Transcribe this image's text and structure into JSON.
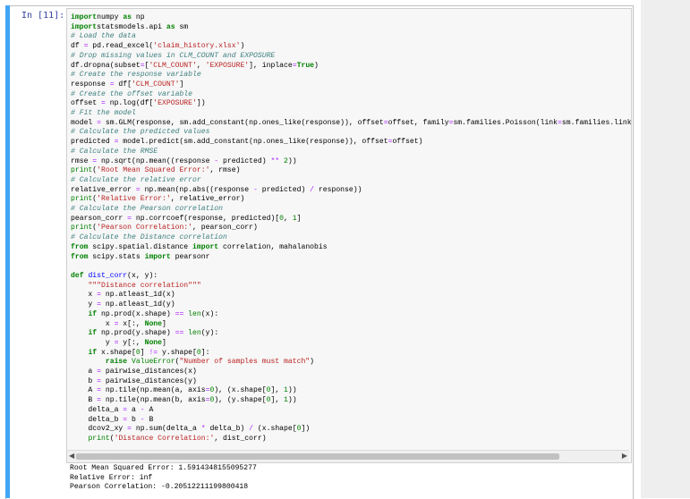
{
  "cell": {
    "prompt": "In [11]:",
    "code_lines": [
      [
        [
          "kw",
          "import"
        ],
        [
          "",
          "numpy "
        ],
        [
          "kw",
          "as"
        ],
        [
          "",
          " np"
        ]
      ],
      [
        [
          "kw",
          "import"
        ],
        [
          "",
          "statsmodels.api "
        ],
        [
          "kw",
          "as"
        ],
        [
          "",
          " sm"
        ]
      ],
      [
        [
          "cm",
          "# Load the data"
        ]
      ],
      [
        [
          "",
          "df "
        ],
        [
          "op",
          "="
        ],
        [
          "",
          " pd.read_excel("
        ],
        [
          "st",
          "'claim_history.xlsx'"
        ],
        [
          "",
          ")"
        ]
      ],
      [
        [
          "cm",
          "# Drop missing values in CLM_COUNT and EXPOSURE"
        ]
      ],
      [
        [
          "",
          "df.dropna(subset"
        ],
        [
          "op",
          "="
        ],
        [
          "",
          "["
        ],
        [
          "st",
          "'CLM_COUNT'"
        ],
        [
          "",
          ", "
        ],
        [
          "st",
          "'EXPOSURE'"
        ],
        [
          "",
          "], inplace"
        ],
        [
          "op",
          "="
        ],
        [
          "kw",
          "True"
        ],
        [
          "",
          ")"
        ]
      ],
      [
        [
          "cm",
          "# Create the response variable"
        ]
      ],
      [
        [
          "",
          "response "
        ],
        [
          "op",
          "="
        ],
        [
          "",
          " df["
        ],
        [
          "st",
          "'CLM_COUNT'"
        ],
        [
          "",
          "]"
        ]
      ],
      [
        [
          "cm",
          "# Create the offset variable"
        ]
      ],
      [
        [
          "",
          "offset "
        ],
        [
          "op",
          "="
        ],
        [
          "",
          " np.log(df["
        ],
        [
          "st",
          "'EXPOSURE'"
        ],
        [
          "",
          "])"
        ]
      ],
      [
        [
          "cm",
          "# Fit the model"
        ]
      ],
      [
        [
          "",
          "model "
        ],
        [
          "op",
          "="
        ],
        [
          "",
          " sm.GLM(response, sm.add_constant(np.ones_like(response)), offset"
        ],
        [
          "op",
          "="
        ],
        [
          "",
          "offset, family"
        ],
        [
          "op",
          "="
        ],
        [
          "",
          "sm.families.Poisson(link"
        ],
        [
          "op",
          "="
        ],
        [
          "",
          "sm.families.link"
        ]
      ],
      [
        [
          "cm",
          "# Calculate the predicted values"
        ]
      ],
      [
        [
          "",
          "predicted "
        ],
        [
          "op",
          "="
        ],
        [
          "",
          " model.predict(sm.add_constant(np.ones_like(response)), offset"
        ],
        [
          "op",
          "="
        ],
        [
          "",
          "offset)"
        ]
      ],
      [
        [
          "cm",
          "# Calculate the RMSE"
        ]
      ],
      [
        [
          "",
          "rmse "
        ],
        [
          "op",
          "="
        ],
        [
          "",
          " np.sqrt(np.mean((response "
        ],
        [
          "op",
          "-"
        ],
        [
          "",
          " predicted) "
        ],
        [
          "op",
          "**"
        ],
        [
          "",
          " "
        ],
        [
          "nm",
          "2"
        ],
        [
          "",
          "))"
        ]
      ],
      [
        [
          "nm",
          "print"
        ],
        [
          "",
          "("
        ],
        [
          "st",
          "'Root Mean Squared Error:'"
        ],
        [
          "",
          ", rmse)"
        ]
      ],
      [
        [
          "cm",
          "# Calculate the relative error"
        ]
      ],
      [
        [
          "",
          "relative_error "
        ],
        [
          "op",
          "="
        ],
        [
          "",
          " np.mean(np.abs((response "
        ],
        [
          "op",
          "-"
        ],
        [
          "",
          " predicted) "
        ],
        [
          "op",
          "/"
        ],
        [
          "",
          " response))"
        ]
      ],
      [
        [
          "nm",
          "print"
        ],
        [
          "",
          "("
        ],
        [
          "st",
          "'Relative Error:'"
        ],
        [
          "",
          ", relative_error)"
        ]
      ],
      [
        [
          "cm",
          "# Calculate the Pearson correlation"
        ]
      ],
      [
        [
          "",
          "pearson_corr "
        ],
        [
          "op",
          "="
        ],
        [
          "",
          " np.corrcoef(response, predicted)["
        ],
        [
          "nm",
          "0"
        ],
        [
          "",
          ", "
        ],
        [
          "nm",
          "1"
        ],
        [
          "",
          "]"
        ]
      ],
      [
        [
          "nm",
          "print"
        ],
        [
          "",
          "("
        ],
        [
          "st",
          "'Pearson Correlation:'"
        ],
        [
          "",
          ", pearson_corr)"
        ]
      ],
      [
        [
          "cm",
          "# Calculate the Distance correlation"
        ]
      ],
      [
        [
          "kw",
          "from"
        ],
        [
          "",
          " scipy.spatial.distance "
        ],
        [
          "kw",
          "import"
        ],
        [
          "",
          " correlation, mahalanobis"
        ]
      ],
      [
        [
          "kw",
          "from"
        ],
        [
          "",
          " scipy.stats "
        ],
        [
          "kw",
          "import"
        ],
        [
          "",
          " pearsonr"
        ]
      ],
      [
        [
          "",
          ""
        ]
      ],
      [
        [
          "kw",
          "def"
        ],
        [
          "",
          " "
        ],
        [
          "fn",
          "dist_corr"
        ],
        [
          "",
          "(x, y):"
        ]
      ],
      [
        [
          "",
          "    "
        ],
        [
          "st",
          "\"\"\"Distance correlation\"\"\""
        ]
      ],
      [
        [
          "",
          "    x "
        ],
        [
          "op",
          "="
        ],
        [
          "",
          " np.atleast_1d(x)"
        ]
      ],
      [
        [
          "",
          "    y "
        ],
        [
          "op",
          "="
        ],
        [
          "",
          " np.atleast_1d(y)"
        ]
      ],
      [
        [
          "",
          "    "
        ],
        [
          "kw",
          "if"
        ],
        [
          "",
          " np.prod(x.shape) "
        ],
        [
          "op",
          "=="
        ],
        [
          "",
          " "
        ],
        [
          "nm",
          "len"
        ],
        [
          "",
          "(x):"
        ]
      ],
      [
        [
          "",
          "        x "
        ],
        [
          "op",
          "="
        ],
        [
          "",
          " x[:, "
        ],
        [
          "kw",
          "None"
        ],
        [
          "",
          "]"
        ]
      ],
      [
        [
          "",
          "    "
        ],
        [
          "kw",
          "if"
        ],
        [
          "",
          " np.prod(y.shape) "
        ],
        [
          "op",
          "=="
        ],
        [
          "",
          " "
        ],
        [
          "nm",
          "len"
        ],
        [
          "",
          "(y):"
        ]
      ],
      [
        [
          "",
          "        y "
        ],
        [
          "op",
          "="
        ],
        [
          "",
          " y[:, "
        ],
        [
          "kw",
          "None"
        ],
        [
          "",
          "]"
        ]
      ],
      [
        [
          "",
          "    "
        ],
        [
          "kw",
          "if"
        ],
        [
          "",
          " x.shape["
        ],
        [
          "nm",
          "0"
        ],
        [
          "",
          "] "
        ],
        [
          "op",
          "!="
        ],
        [
          "",
          " y.shape["
        ],
        [
          "nm",
          "0"
        ],
        [
          "",
          "]:"
        ]
      ],
      [
        [
          "",
          "        "
        ],
        [
          "kw",
          "raise"
        ],
        [
          "",
          " "
        ],
        [
          "nm",
          "ValueError"
        ],
        [
          "",
          "("
        ],
        [
          "st",
          "\"Number of samples must match\""
        ],
        [
          "",
          ")"
        ]
      ],
      [
        [
          "",
          "    a "
        ],
        [
          "op",
          "="
        ],
        [
          "",
          " pairwise_distances(x)"
        ]
      ],
      [
        [
          "",
          "    b "
        ],
        [
          "op",
          "="
        ],
        [
          "",
          " pairwise_distances(y)"
        ]
      ],
      [
        [
          "",
          "    A "
        ],
        [
          "op",
          "="
        ],
        [
          "",
          " np.tile(np.mean(a, axis"
        ],
        [
          "op",
          "="
        ],
        [
          "nm",
          "0"
        ],
        [
          "",
          "), (x.shape["
        ],
        [
          "nm",
          "0"
        ],
        [
          "",
          "], "
        ],
        [
          "nm",
          "1"
        ],
        [
          "",
          "))"
        ]
      ],
      [
        [
          "",
          "    B "
        ],
        [
          "op",
          "="
        ],
        [
          "",
          " np.tile(np.mean(b, axis"
        ],
        [
          "op",
          "="
        ],
        [
          "nm",
          "0"
        ],
        [
          "",
          "), (y.shape["
        ],
        [
          "nm",
          "0"
        ],
        [
          "",
          "], "
        ],
        [
          "nm",
          "1"
        ],
        [
          "",
          "))"
        ]
      ],
      [
        [
          "",
          "    delta_a "
        ],
        [
          "op",
          "="
        ],
        [
          "",
          " a "
        ],
        [
          "op",
          "-"
        ],
        [
          "",
          " A"
        ]
      ],
      [
        [
          "",
          "    delta_b "
        ],
        [
          "op",
          "="
        ],
        [
          "",
          " b "
        ],
        [
          "op",
          "-"
        ],
        [
          "",
          " B"
        ]
      ],
      [
        [
          "",
          "    dcov2_xy "
        ],
        [
          "op",
          "="
        ],
        [
          "",
          " np.sum(delta_a "
        ],
        [
          "op",
          "*"
        ],
        [
          "",
          " delta_b) "
        ],
        [
          "op",
          "/"
        ],
        [
          "",
          " (x.shape["
        ],
        [
          "nm",
          "0"
        ],
        [
          "",
          "])"
        ]
      ],
      [
        [
          "",
          "    "
        ],
        [
          "nm",
          "print"
        ],
        [
          "",
          "("
        ],
        [
          "st",
          "'Distance Correlation:'"
        ],
        [
          "",
          ", dist_corr)"
        ]
      ]
    ],
    "output_lines": [
      "Root Mean Squared Error: 1.5914348155095277",
      "Relative Error: inf",
      "Pearson Correlation: -0.20512211199800418"
    ],
    "scroll_left_icon": "triangle-left",
    "scroll_right_icon": "triangle-right"
  }
}
